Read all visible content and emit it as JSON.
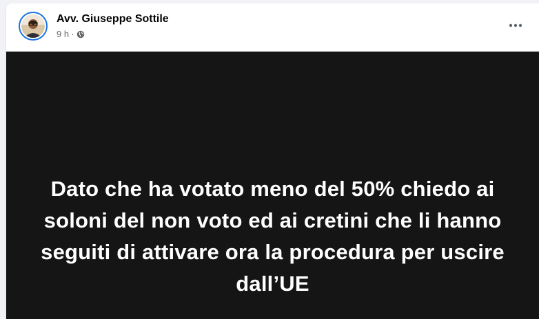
{
  "post": {
    "author": "Avv. Giuseppe Sottile",
    "time": "9 h",
    "separator": "·",
    "privacy_icon": "globe-icon",
    "menu_icon": "more-horizontal-icon",
    "text": "Dato che ha votato meno del 50% chiedo ai soloni del non voto ed ai cretini che li hanno seguiti di attivare ora la procedura per uscire dall’UE"
  },
  "colors": {
    "avatar_ring": "#1b74e4",
    "media_background": "#151515",
    "secondary_text": "#65676b"
  }
}
